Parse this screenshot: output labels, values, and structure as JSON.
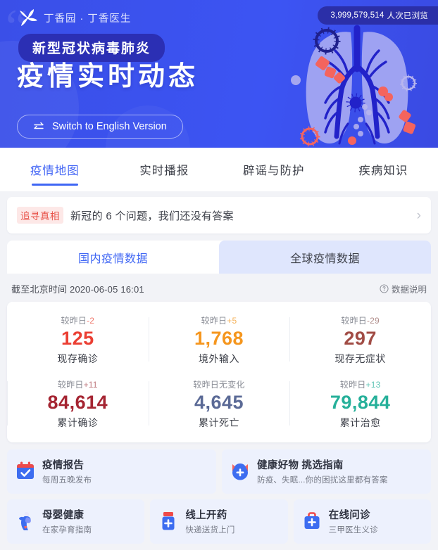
{
  "hero": {
    "viewcount_number": "3,999,579,514",
    "viewcount_label": "人次已浏览",
    "logo_text": "丁香园 · 丁香医生",
    "logo_icon": "clover-leaf-icon",
    "tag": "新型冠状病毒肺炎",
    "title": "疫情实时动态",
    "switch_label": "Switch to English Version",
    "switch_icon": "swap-arrows-icon",
    "art": "lungs-virus-illustration",
    "colors": {
      "bg_start": "#3a4fe8",
      "bg_end": "#3a4ae2",
      "pill_bg": "#2b2fa8",
      "tag_bg": "#2b2fb4",
      "lung_fill": "#9ea2f2",
      "bronchi": "#2222c9",
      "virus_red": "#f4645e",
      "virus_navy": "#1f1f8c"
    }
  },
  "nav": {
    "items": [
      {
        "label": "疫情地图",
        "active": true
      },
      {
        "label": "实时播报",
        "active": false
      },
      {
        "label": "辟谣与防护",
        "active": false
      },
      {
        "label": "疾病知识",
        "active": false
      }
    ],
    "active_color": "#4668f5"
  },
  "truth_banner": {
    "tag": "追寻真相",
    "tag_color": "#e8534a",
    "tag_bg": "#fde8e7",
    "text": "新冠的 6 个问题，我们还没有答案",
    "chevron_icon": "chevron-right-icon"
  },
  "data_panel": {
    "tabs": [
      {
        "label": "国内疫情数据",
        "active": true
      },
      {
        "label": "全球疫情数据",
        "active": false
      }
    ],
    "timestamp": "截至北京时间 2020-06-05 16:01",
    "help_label": "数据说明",
    "help_icon": "question-circle-icon",
    "stats": [
      {
        "delta": "较昨日",
        "delta_value": "-2",
        "value": "125",
        "label": "现存确诊",
        "color": "#eb3f33",
        "delta_color": "#f07a6e"
      },
      {
        "delta": "较昨日",
        "delta_value": "+5",
        "value": "1,768",
        "label": "境外输入",
        "color": "#f5961e",
        "delta_color": "#f5b35c"
      },
      {
        "delta": "较昨日",
        "delta_value": "-29",
        "value": "297",
        "label": "现存无症状",
        "color": "#a14c45",
        "delta_color": "#b08d8a"
      },
      {
        "delta": "较昨日",
        "delta_value": "+11",
        "value": "84,614",
        "label": "累计确诊",
        "color": "#a52532",
        "delta_color": "#bf7b80"
      },
      {
        "delta": "较昨日无变化",
        "delta_value": "",
        "value": "4,645",
        "label": "累计死亡",
        "color": "#5b6a96",
        "delta_color": "#8a8d96"
      },
      {
        "delta": "较昨日",
        "delta_value": "+13",
        "value": "79,844",
        "label": "累计治愈",
        "color": "#26b09a",
        "delta_color": "#5fc4b4"
      }
    ]
  },
  "services": {
    "row1": [
      {
        "title": "疫情报告",
        "subtitle": "每周五晚发布",
        "icon": "calendar-check-icon"
      },
      {
        "title": "健康好物 挑选指南",
        "subtitle": "防疫、失眠...你的困扰这里都有答案",
        "icon": "cat-mascot-plus-icon"
      }
    ],
    "row2": [
      {
        "title": "母婴健康",
        "subtitle": "在家孕育指南",
        "icon": "pregnant-woman-icon"
      },
      {
        "title": "线上开药",
        "subtitle": "快递送货上门",
        "icon": "medicine-bottle-icon"
      },
      {
        "title": "在线问诊",
        "subtitle": "三甲医生义诊",
        "icon": "medical-bag-icon"
      }
    ]
  }
}
